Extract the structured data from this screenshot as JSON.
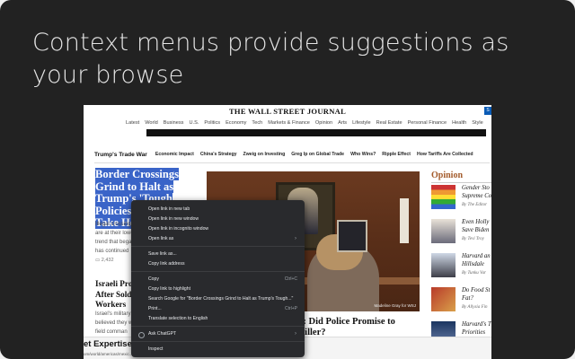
{
  "headline": "Context menus provide suggestions as your browse",
  "site": {
    "masthead": "THE WALL STREET JOURNAL",
    "top_nav": [
      "Latest",
      "World",
      "Business",
      "U.S.",
      "Politics",
      "Economy",
      "Tech",
      "Markets & Finance",
      "Opinion",
      "Arts",
      "Lifestyle",
      "Real Estate",
      "Personal Finance",
      "Health",
      "Style"
    ],
    "sub_nav_lead": "Trump's Trade War",
    "sub_nav": [
      "Economic Impact",
      "China's Strategy",
      "Zweig on Investing",
      "Greg Ip on Global Trade",
      "Who Wins?",
      "Ripple Effect",
      "How Tariffs Are Collected"
    ],
    "story1_lines": [
      "Border Crossings",
      "Grind to Halt as",
      "Trump's 'Tough Policies'",
      "Take Hold"
    ],
    "story1_body": "Illegal crossings are at their lowest trend that began has continued",
    "story1_meta": "2,432",
    "story2_title": "Israeli Prob After Soldie Workers",
    "story2_body": "Israel's military believed they w a field comman",
    "photo_credit": "Madeline Gray for WSJ",
    "story3_title": "f': Did Police Promise to",
    "story3_line2": "Killer?",
    "opinion_title": "Opinion",
    "opinion_items": [
      {
        "head": "Gender Sto",
        "line2": "Supreme Co",
        "by": "By The Editor"
      },
      {
        "head": "Even Holly",
        "line2": "Save Biden",
        "by": "By Tevi Troy"
      },
      {
        "head": "Harvard an",
        "line2": "Hillsdale",
        "by": "By Tunku Var"
      },
      {
        "head": "Do Food St",
        "line2": "Fat?",
        "by": "By Allysia Fin"
      },
      {
        "head": "Harvard's T",
        "line2": "Priorities",
        "by": ""
      }
    ],
    "banner_text": "et Expertise.",
    "banner_url": "om/world/americas/mexic..."
  },
  "context_menu": {
    "groups": [
      [
        {
          "label": "Open link in new tab"
        },
        {
          "label": "Open link in new window"
        },
        {
          "label": "Open link in incognito window"
        },
        {
          "label": "Open link as",
          "submenu": true
        }
      ],
      [
        {
          "label": "Save link as..."
        },
        {
          "label": "Copy link address"
        }
      ],
      [
        {
          "label": "Copy",
          "shortcut": "Ctrl+C"
        },
        {
          "label": "Copy link to highlight"
        },
        {
          "label": "Search Google for \"Border Crossings Grind to Halt as Trump's Tough...\""
        },
        {
          "label": "Print...",
          "shortcut": "Ctrl+P"
        },
        {
          "label": "Translate selection to English"
        }
      ],
      [
        {
          "label": "Ask ChatGPT",
          "submenu": true,
          "icon": "chatgpt-icon"
        }
      ],
      [
        {
          "label": "Inspect"
        }
      ]
    ]
  },
  "colors": {
    "card_bg": "#222222",
    "headline_text": "#e4e4e4",
    "selection": "#3a64c8",
    "menu_bg": "#292a2d",
    "opinion_accent": "#a35a2a"
  }
}
